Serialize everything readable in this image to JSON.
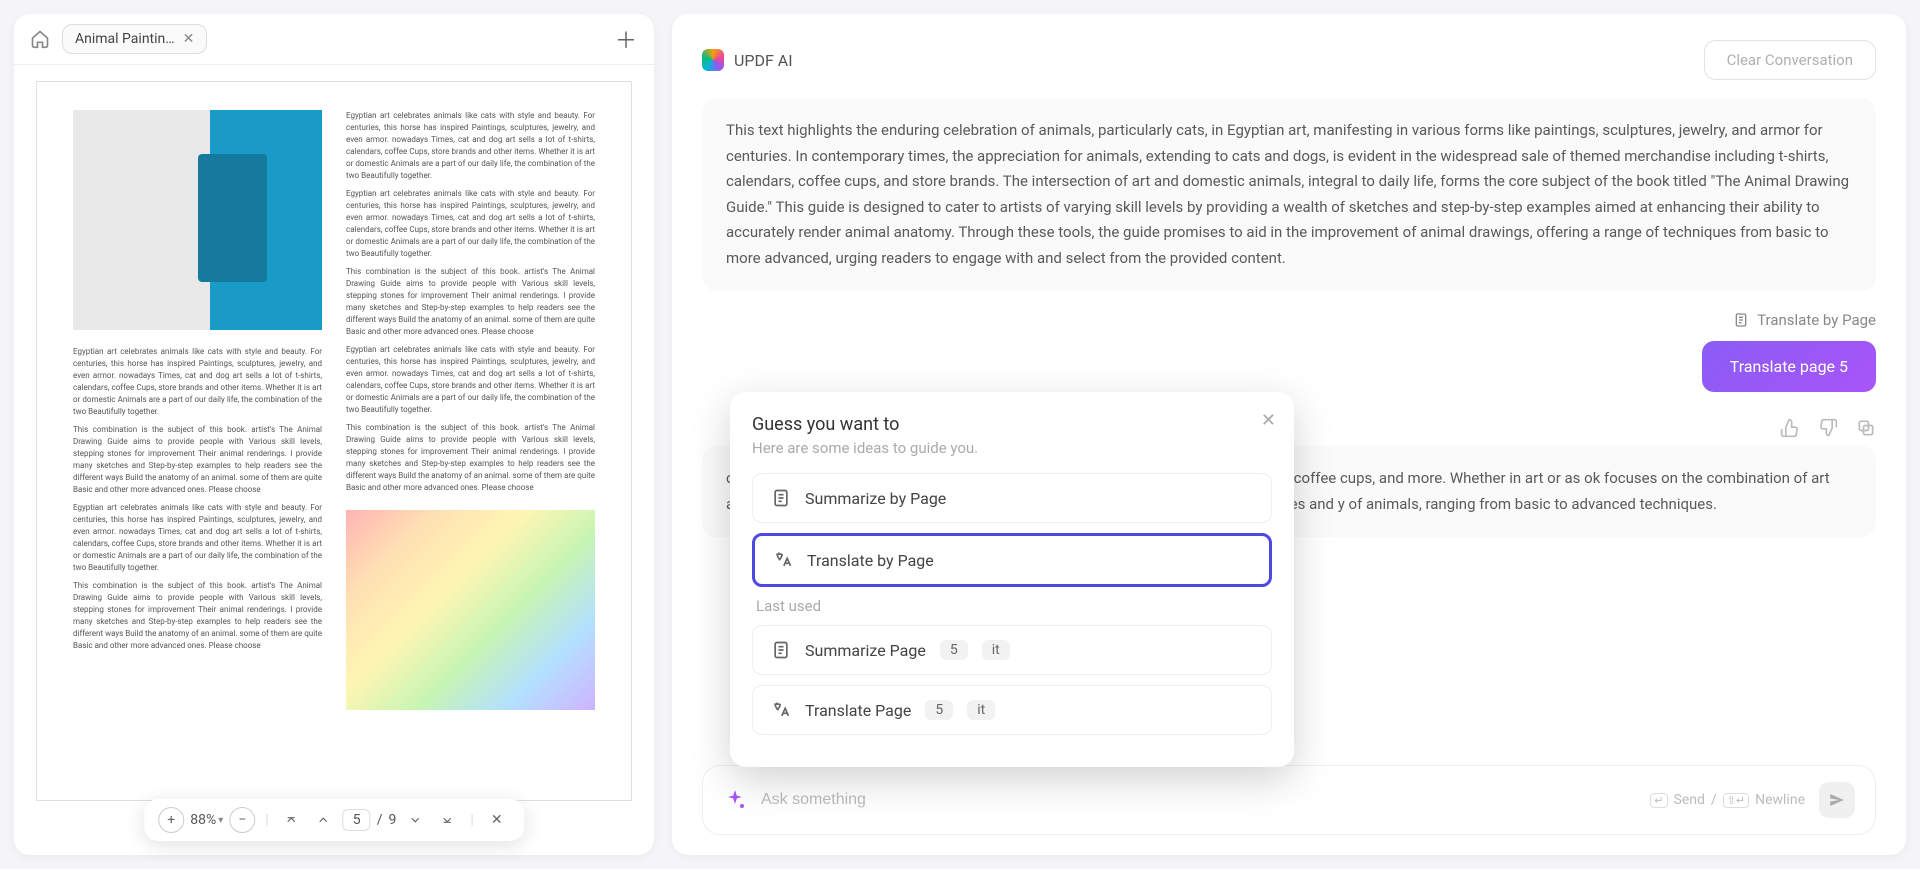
{
  "tab": {
    "label": "Animal Paintin…"
  },
  "toolbar": {
    "zoom": "88%",
    "current_page": "5",
    "total_pages": "9"
  },
  "doc": {
    "paragraph": "Egyptian art celebrates animals like cats with style and beauty. For centuries, this horse has inspired Paintings, sculptures, jewelry, and even armor. nowadays Times, cat and dog art sells a lot of t-shirts, calendars, coffee Cups, store brands and other items. Whether it is art or domestic Animals are a part of our daily life, the combination of the two Beautifully together.",
    "paragraph2": "This combination is the subject of this book. artist's The Animal Drawing Guide aims to provide people with Various skill levels, stepping stones for improvement Their animal renderings. I provide many sketches and Step-by-step examples to help readers see the different ways Build the anatomy of an animal. some of them are quite Basic and other more advanced ones. Please choose"
  },
  "chat": {
    "brand": "UPDF AI",
    "clear_label": "Clear Conversation",
    "bubble1": "This text highlights the enduring celebration of animals, particularly cats, in Egyptian art, manifesting in various forms like paintings, sculptures, jewelry, and armor for centuries. In contemporary times, the appreciation for animals, extending to cats and dogs, is evident in the widespread sale of themed merchandise including t-shirts, calendars, coffee cups, and store brands. The intersection of art and domestic animals, integral to daily life, forms the core subject of the book titled \"The Animal Drawing Guide.\" This guide is designed to cater to artists of varying skill levels by providing a wealth of sketches and step-by-step examples aimed at enhancing their ability to accurately render animal anatomy. Through these tools, the guide promises to aid in the improvement of animal drawings, offering a range of techniques from basic to more advanced, urging readers to engage with and select from the provided content.",
    "translate_header": "Translate by Page",
    "translate_button": "Translate page 5",
    "bubble2": "centuries, this has inspired paintings, sculptures, jewelry, and even t-shirts, calendars, coffee cups, and more. Whether in art or as ok focuses on the combination of art and animals. The Animal improve their animal drawings. It includes numerous sketches and y of animals, ranging from basic to advanced techniques.",
    "input_placeholder": "Ask something",
    "hint_send": "Send",
    "hint_sep": "/",
    "hint_newline": "Newline"
  },
  "popup": {
    "title": "Guess you want to",
    "subtitle": "Here are some ideas to guide you.",
    "item_summarize": "Summarize by Page",
    "item_translate": "Translate by Page",
    "last_used_label": "Last used",
    "recent_summarize": "Summarize Page",
    "recent_summarize_badge1": "5",
    "recent_summarize_badge2": "it",
    "recent_translate": "Translate Page",
    "recent_translate_badge1": "5",
    "recent_translate_badge2": "it"
  }
}
